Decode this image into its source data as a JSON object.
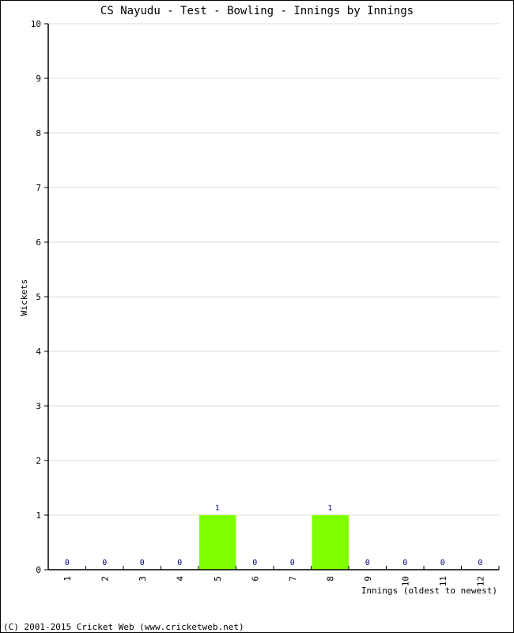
{
  "chart_data": {
    "type": "bar",
    "title": "CS Nayudu - Test - Bowling - Innings by Innings",
    "xlabel": "Innings (oldest to newest)",
    "ylabel": "Wickets",
    "categories": [
      "1",
      "2",
      "3",
      "4",
      "5",
      "6",
      "7",
      "8",
      "9",
      "10",
      "11",
      "12"
    ],
    "values": [
      0,
      0,
      0,
      0,
      1,
      0,
      0,
      1,
      0,
      0,
      0,
      0
    ],
    "data_labels": [
      "0",
      "0",
      "0",
      "0",
      "1",
      "0",
      "0",
      "1",
      "0",
      "0",
      "0",
      "0"
    ],
    "ylim": [
      0,
      10
    ],
    "yticks": [
      "0",
      "1",
      "2",
      "3",
      "4",
      "5",
      "6",
      "7",
      "8",
      "9",
      "10"
    ],
    "grid": true,
    "legend": "none",
    "bar_color": "#80ff00",
    "label_color": "#000080"
  },
  "footer": {
    "copyright": "(C) 2001-2015 Cricket Web (www.cricketweb.net)"
  }
}
